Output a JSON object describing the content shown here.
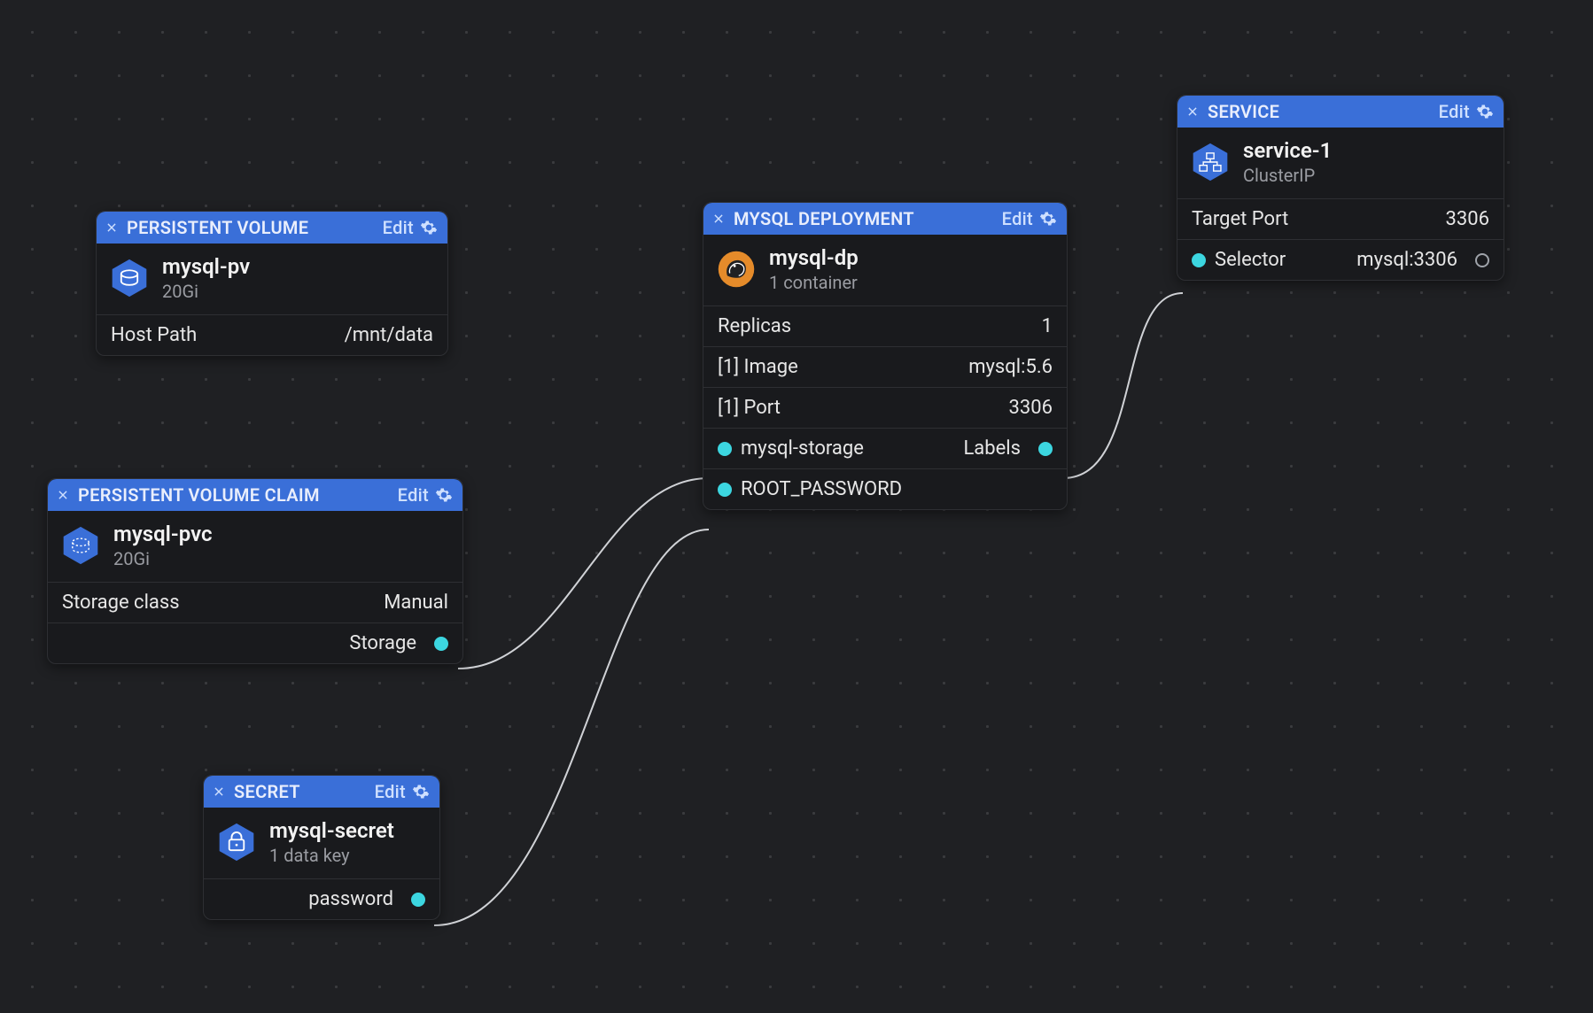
{
  "common": {
    "edit": "Edit"
  },
  "pv": {
    "header": "PERSISTENT VOLUME",
    "name": "mysql-pv",
    "size": "20Gi",
    "hostpath_label": "Host Path",
    "hostpath_value": "/mnt/data"
  },
  "pvc": {
    "header": "PERSISTENT VOLUME CLAIM",
    "name": "mysql-pvc",
    "size": "20Gi",
    "storageclass_label": "Storage class",
    "storageclass_value": "Manual",
    "storage_port_label": "Storage"
  },
  "secret": {
    "header": "SECRET",
    "name": "mysql-secret",
    "sub": "1 data key",
    "password_port_label": "password"
  },
  "dp": {
    "header": "MYSQL DEPLOYMENT",
    "name": "mysql-dp",
    "sub": "1 container",
    "replicas_label": "Replicas",
    "replicas_value": "1",
    "image_label": "[1] Image",
    "image_value": "mysql:5.6",
    "port_label": "[1] Port",
    "port_value": "3306",
    "storage_in_label": "mysql-storage",
    "labels_out_label": "Labels",
    "rootpw_in_label": "ROOT_PASSWORD"
  },
  "svc": {
    "header": "SERVICE",
    "name": "service-1",
    "sub": "ClusterIP",
    "targetport_label": "Target Port",
    "targetport_value": "3306",
    "selector_label": "Selector",
    "selector_value": "mysql:3306"
  },
  "icons": {
    "close": "close-icon",
    "gear": "gear-icon",
    "db": "database-icon",
    "mysql": "mysql-icon",
    "service": "service-icon",
    "secret": "secret-icon",
    "pvc": "pvc-icon"
  }
}
